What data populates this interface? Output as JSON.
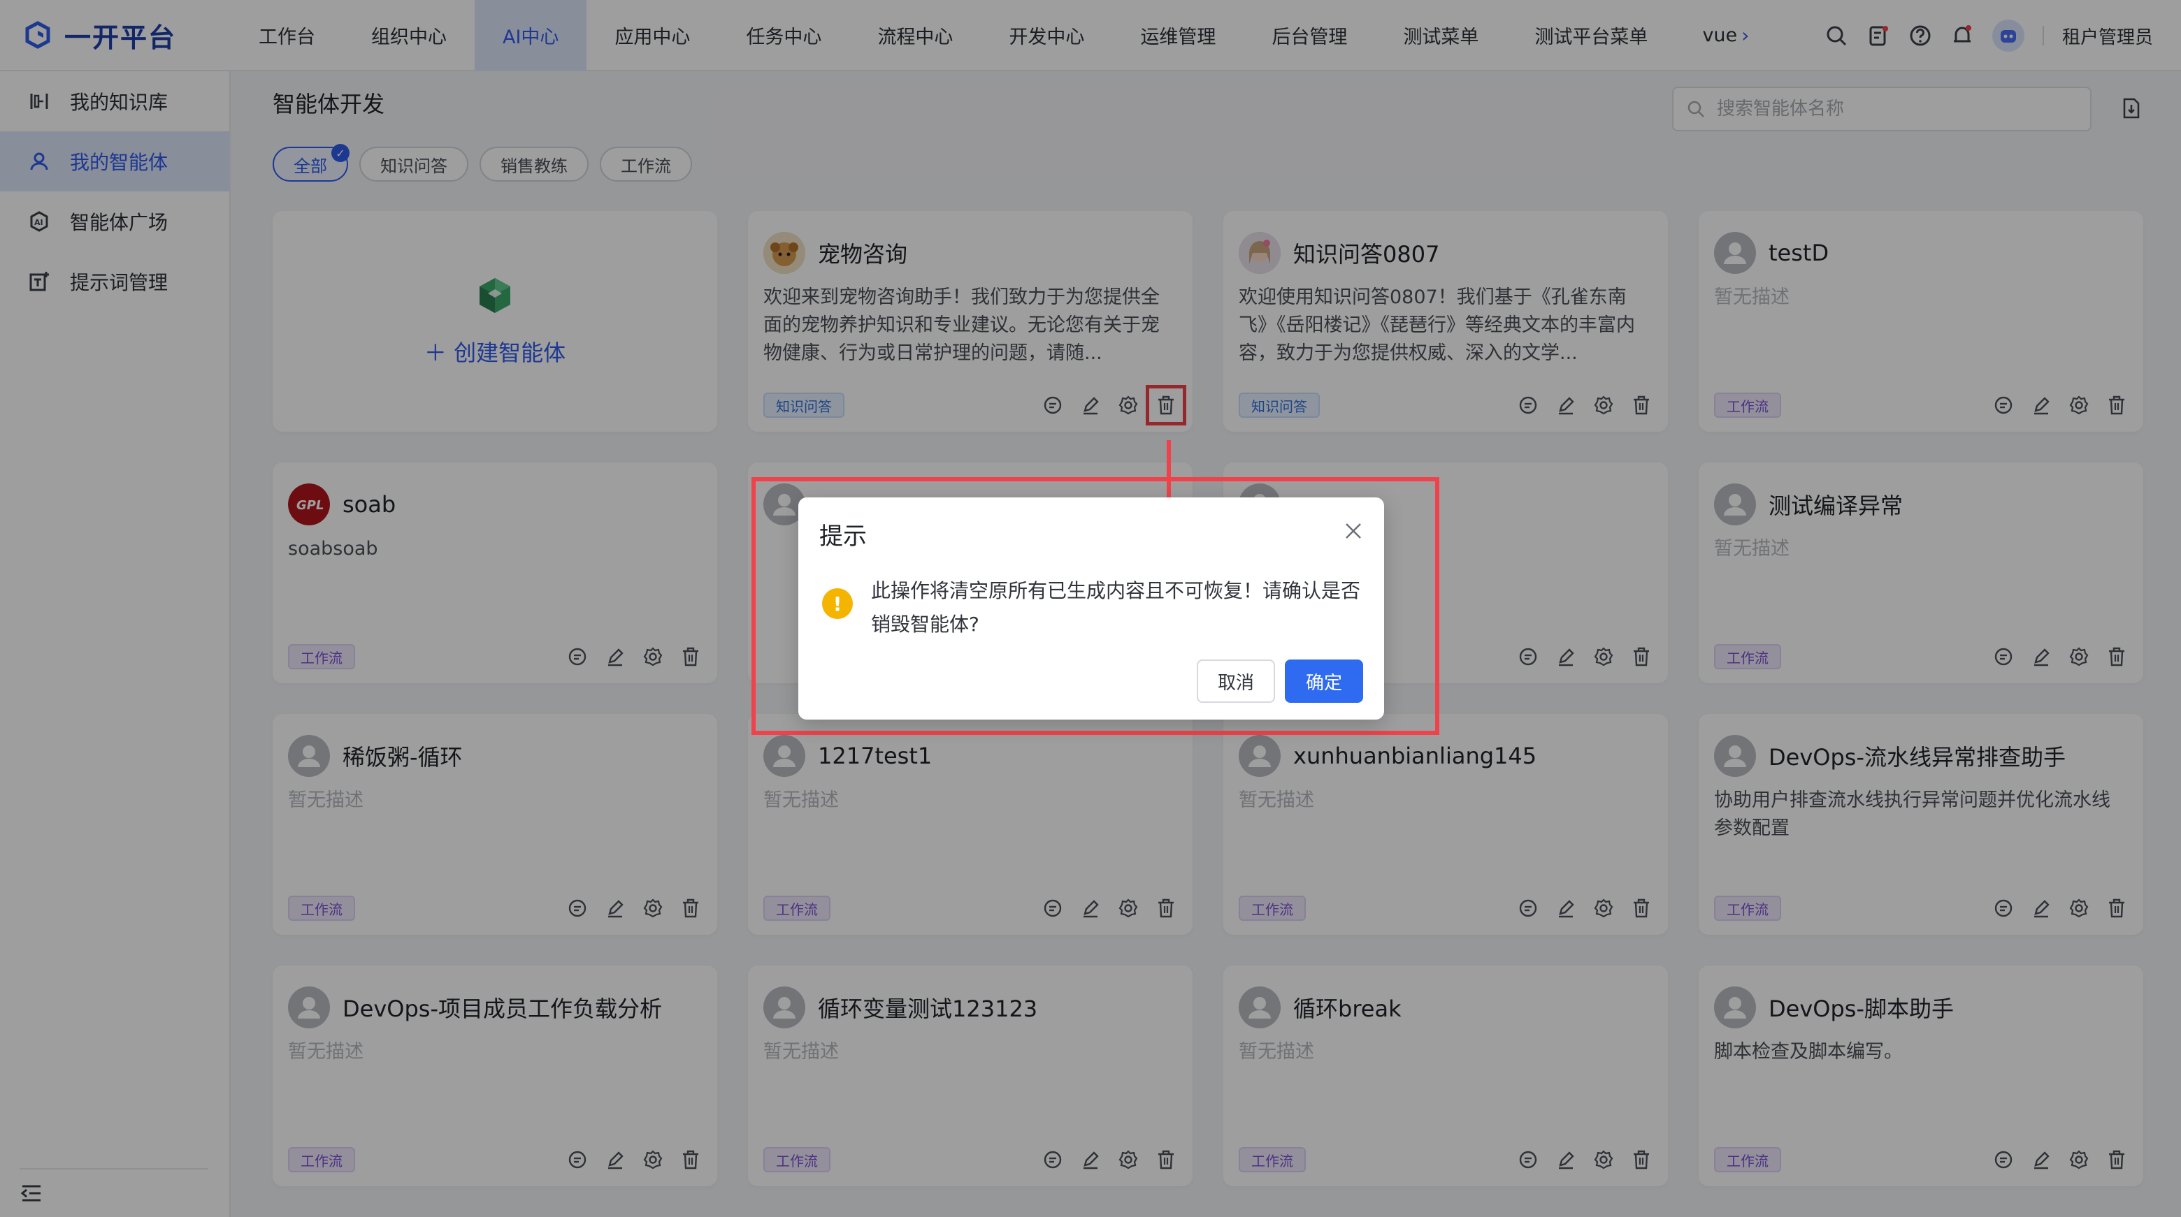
{
  "brand": {
    "name": "一开平台"
  },
  "nav": {
    "items": [
      "工作台",
      "组织中心",
      "AI中心",
      "应用中心",
      "任务中心",
      "流程中心",
      "开发中心",
      "运维管理",
      "后台管理",
      "测试菜单",
      "测试平台菜单"
    ],
    "more": "vue",
    "active_index": 2
  },
  "user": {
    "name": "租户管理员"
  },
  "sidebar": {
    "items": [
      {
        "label": "我的知识库",
        "icon": "knowledge-icon"
      },
      {
        "label": "我的智能体",
        "icon": "user-icon"
      },
      {
        "label": "智能体广场",
        "icon": "ai-plaza-icon"
      },
      {
        "label": "提示词管理",
        "icon": "prompt-edit-icon"
      }
    ],
    "active_index": 1
  },
  "page": {
    "title": "智能体开发"
  },
  "search": {
    "placeholder": "搜索智能体名称"
  },
  "filters": [
    "全部",
    "知识问答",
    "销售教练",
    "工作流"
  ],
  "create": {
    "label": "创建智能体"
  },
  "cards": [
    {
      "title": "宠物咨询",
      "desc": "欢迎来到宠物咨询助手！我们致力于为您提供全面的宠物养护知识和专业建议。无论您有关于宠物健康、行为或日常护理的问题，请随...",
      "tag": "知识问答",
      "avatar": "pet-avatar"
    },
    {
      "title": "知识问答0807",
      "desc": "欢迎使用知识问答0807！我们基于《孔雀东南飞》《岳阳楼记》《琵琶行》等经典文本的丰富内容，致力于为您提供权威、深入的文学...",
      "tag": "知识问答",
      "avatar": "girl-avatar"
    },
    {
      "title": "testD",
      "desc": "暂无描述",
      "tag": "工作流",
      "avatar": "default-avatar"
    },
    {
      "title": "soab",
      "desc": "soabsoab",
      "tag": "工作流",
      "avatar": "gpl-avatar"
    },
    {
      "title": "",
      "desc": "",
      "tag": "",
      "avatar": "default-avatar"
    },
    {
      "title": "",
      "desc": "",
      "tag": "",
      "avatar": "default-avatar"
    },
    {
      "title": "测试编译异常",
      "desc": "暂无描述",
      "tag": "工作流",
      "avatar": "default-avatar"
    },
    {
      "title": "稀饭粥-循环",
      "desc": "暂无描述",
      "tag": "工作流",
      "avatar": "default-avatar"
    },
    {
      "title": "1217test1",
      "desc": "暂无描述",
      "tag": "工作流",
      "avatar": "default-avatar"
    },
    {
      "title": "xunhuanbianliang145",
      "desc": "暂无描述",
      "tag": "工作流",
      "avatar": "default-avatar"
    },
    {
      "title": "DevOps-流水线异常排查助手",
      "desc": "协助用户排查流水线执行异常问题并优化流水线参数配置",
      "tag": "工作流",
      "avatar": "default-avatar"
    },
    {
      "title": "DevOps-项目成员工作负载分析",
      "desc": "暂无描述",
      "tag": "工作流",
      "avatar": "default-avatar"
    },
    {
      "title": "循环变量测试123123",
      "desc": "暂无描述",
      "tag": "工作流",
      "avatar": "default-avatar"
    },
    {
      "title": "循环break",
      "desc": "暂无描述",
      "tag": "工作流",
      "avatar": "default-avatar"
    },
    {
      "title": "DevOps-脚本助手",
      "desc": "脚本检查及脚本编写。",
      "tag": "工作流",
      "avatar": "default-avatar"
    }
  ],
  "dialog": {
    "title": "提示",
    "message": "此操作将清空原所有已生成内容且不可恢复！请确认是否销毁智能体?",
    "cancel": "取消",
    "confirm": "确定"
  },
  "colors": {
    "accent": "#2f5bea",
    "highlight": "#f0424a",
    "warning": "#f5b400"
  }
}
